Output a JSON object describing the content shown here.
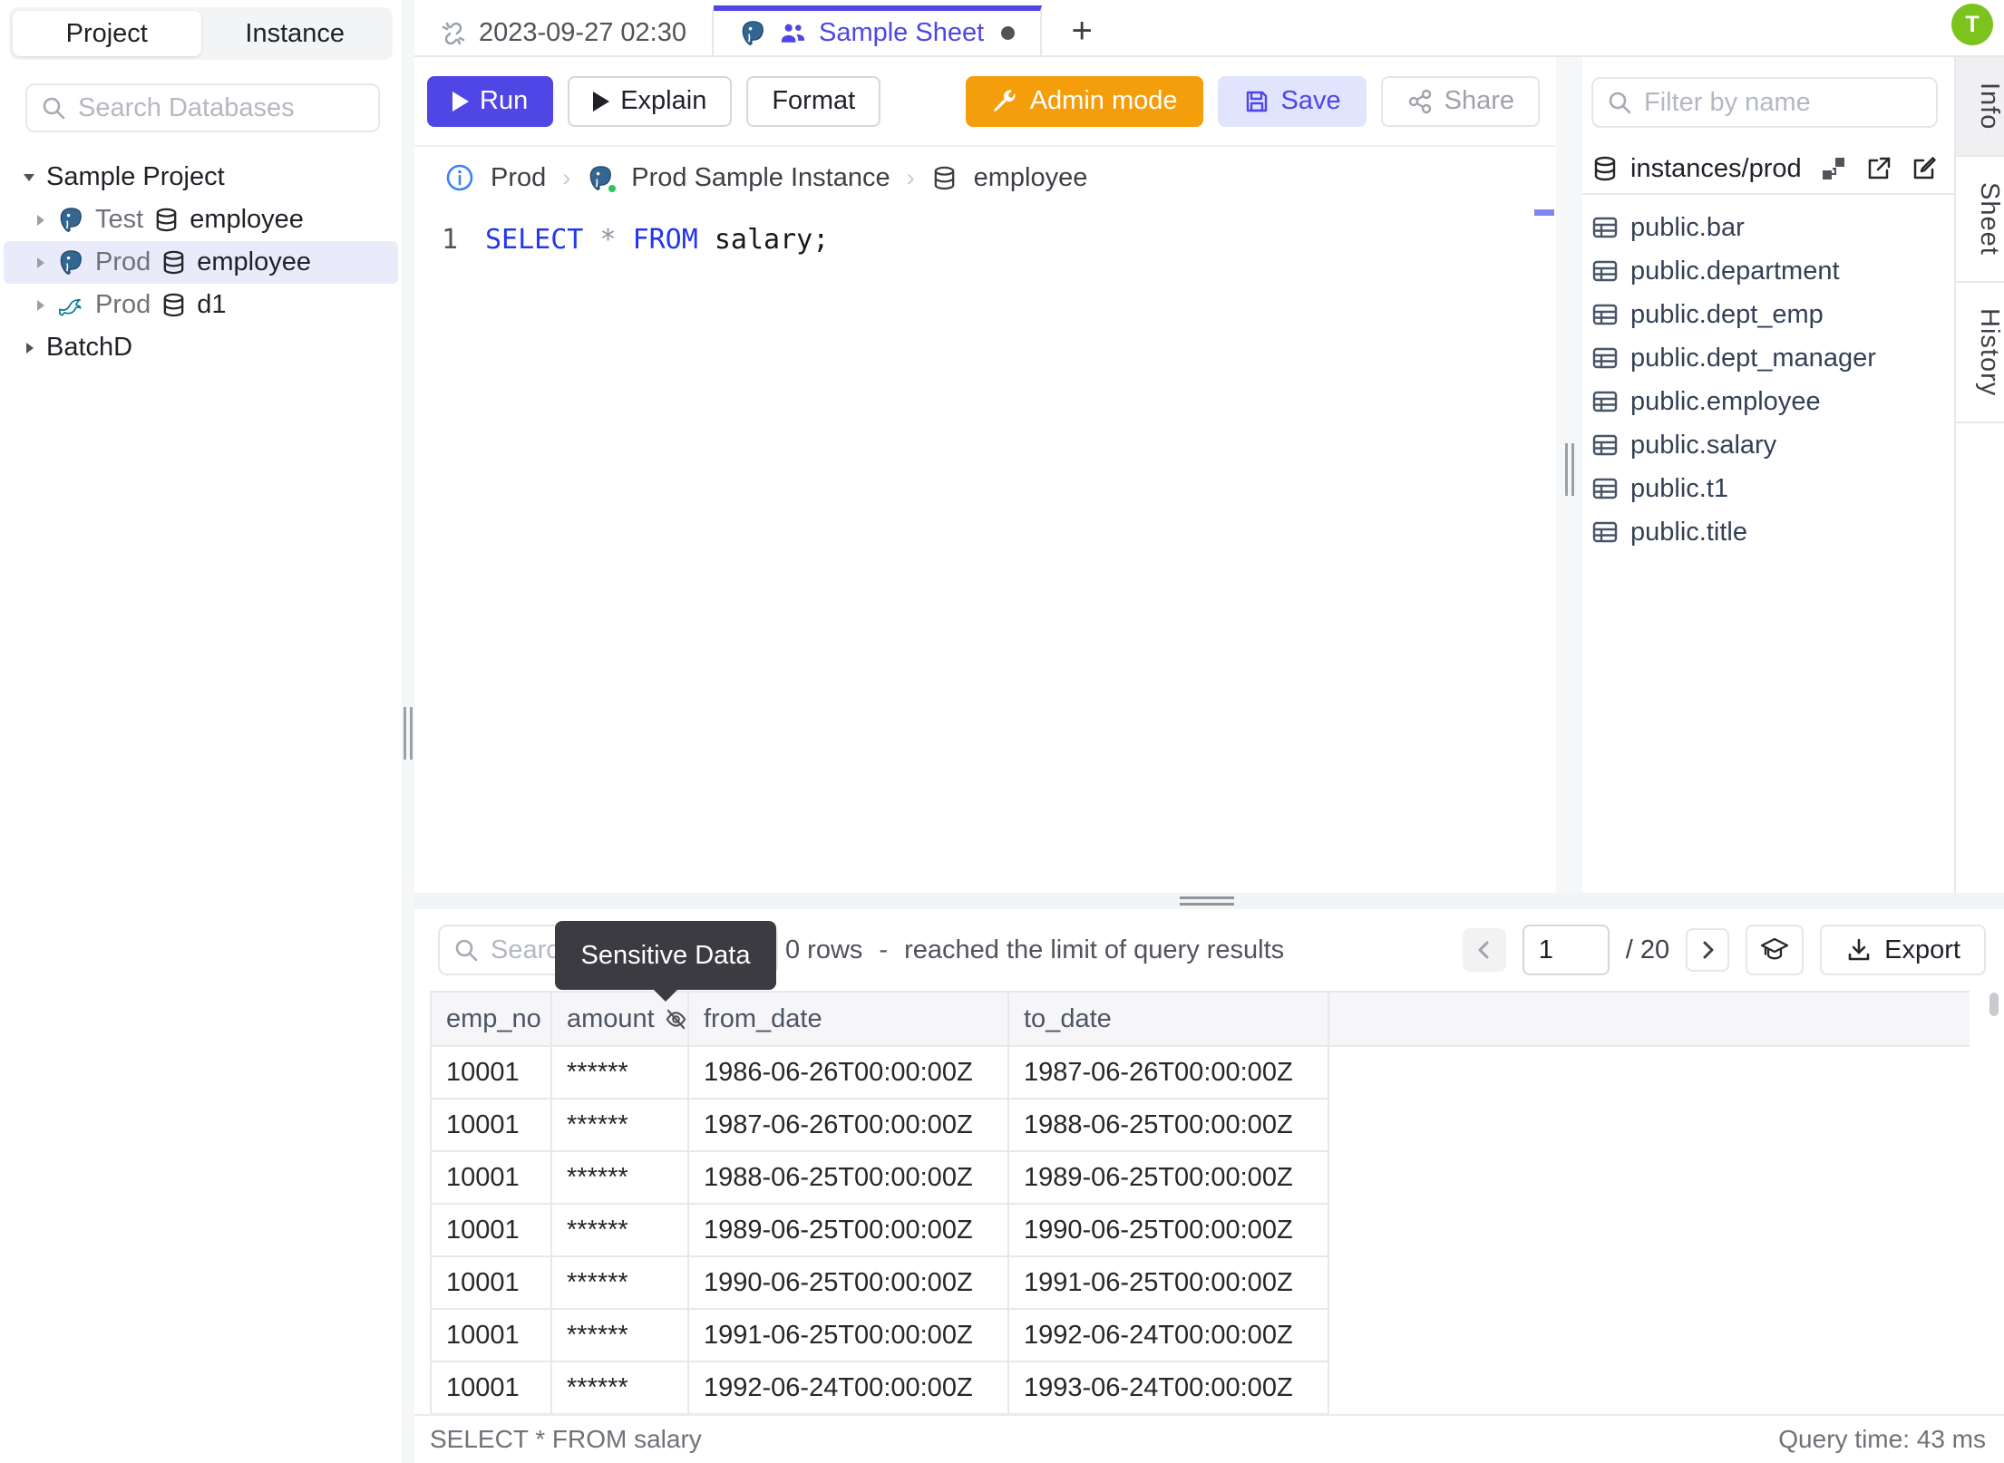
{
  "header": {
    "project_tab": "Project",
    "instance_tab": "Instance",
    "avatar_initial": "T"
  },
  "sidebar": {
    "search_placeholder": "Search Databases",
    "tree": [
      {
        "label": "Sample Project"
      },
      {
        "env": "Test",
        "db": "employee"
      },
      {
        "env": "Prod",
        "db": "employee"
      },
      {
        "env": "Prod",
        "db": "d1"
      },
      {
        "label": "BatchD"
      }
    ]
  },
  "tabbar": {
    "tabs": [
      {
        "label": "2023-09-27 02:30"
      },
      {
        "label": "Sample Sheet"
      }
    ],
    "new_tab_label": "+"
  },
  "toolbar": {
    "run_label": "Run",
    "explain_label": "Explain",
    "format_label": "Format",
    "admin_mode_label": "Admin mode",
    "save_label": "Save",
    "share_label": "Share"
  },
  "breadcrumb": {
    "env": "Prod",
    "instance": "Prod Sample Instance",
    "database": "employee"
  },
  "editor": {
    "line_number": "1",
    "keyword1": "SELECT",
    "star": "*",
    "keyword2": "FROM",
    "identifier": "salary;"
  },
  "right_panel": {
    "filter_placeholder": "Filter by name",
    "source": "instances/prod",
    "tables": [
      "public.bar",
      "public.department",
      "public.dept_emp",
      "public.dept_manager",
      "public.employee",
      "public.salary",
      "public.t1",
      "public.title"
    ],
    "tabs": [
      "Info",
      "Sheet",
      "History"
    ]
  },
  "results": {
    "search_placeholder": "Search",
    "tooltip": "Sensitive Data",
    "rows_summary": "0 rows",
    "summary_separator": "-",
    "limit_note": "reached the limit of query results",
    "page": "1",
    "page_total": "/ 20",
    "export_label": "Export",
    "columns": [
      "emp_no",
      "amount",
      "from_date",
      "to_date"
    ],
    "rows": [
      [
        "10001",
        "******",
        "1986-06-26T00:00:00Z",
        "1987-06-26T00:00:00Z"
      ],
      [
        "10001",
        "******",
        "1987-06-26T00:00:00Z",
        "1988-06-25T00:00:00Z"
      ],
      [
        "10001",
        "******",
        "1988-06-25T00:00:00Z",
        "1989-06-25T00:00:00Z"
      ],
      [
        "10001",
        "******",
        "1989-06-25T00:00:00Z",
        "1990-06-25T00:00:00Z"
      ],
      [
        "10001",
        "******",
        "1990-06-25T00:00:00Z",
        "1991-06-25T00:00:00Z"
      ],
      [
        "10001",
        "******",
        "1991-06-25T00:00:00Z",
        "1992-06-24T00:00:00Z"
      ],
      [
        "10001",
        "******",
        "1992-06-24T00:00:00Z",
        "1993-06-24T00:00:00Z"
      ]
    ],
    "statement": "SELECT * FROM salary",
    "query_time": "Query time: 43 ms"
  },
  "colors": {
    "accent": "#4f46e5",
    "admin_mode": "#f59e0b",
    "save_bg": "#e0e4fc",
    "avatar_green": "#7cc41d",
    "status_green_dot": "#2fc25b",
    "keyword_blue": "#2337ec",
    "selected_row_bg": "#e9ebfb",
    "tooltip_bg": "#3b3b41"
  }
}
